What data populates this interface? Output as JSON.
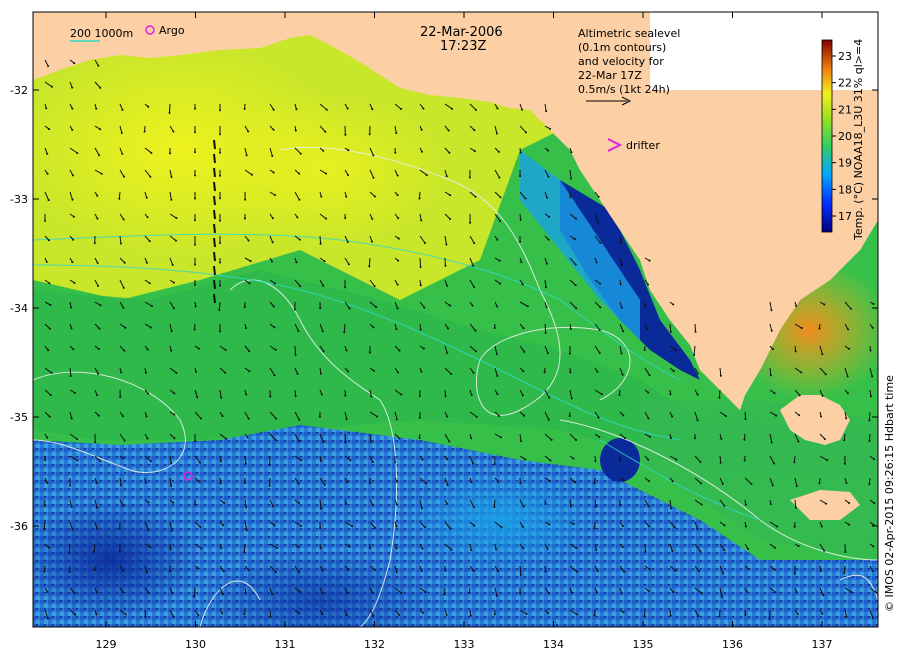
{
  "map": {
    "date": "22-Mar-2006",
    "time": "17:23Z",
    "altimetry_lines": [
      "Altimetric sealevel",
      "(0.1m contours)",
      "and velocity for",
      "22-Mar 17Z",
      "0.5m/s (1kt 24h)"
    ],
    "depth_legend": "200  1000m",
    "argo_label": "Argo",
    "drifter_label": "drifter",
    "colorbar_title": "Temp. (°C) NOAA18_L3U 31% ql>=4",
    "colorbar_ticks": [
      "17",
      "18",
      "19",
      "20",
      "21",
      "22",
      "23"
    ],
    "colorbar_range": [
      16.4,
      23.6
    ],
    "credit": "© IMOS 02-Apr-2015 09:26:15 Hdbart time",
    "lon_ticks": [
      "129",
      "130",
      "131",
      "132",
      "133",
      "134",
      "135",
      "136",
      "137"
    ],
    "lat_ticks": [
      "-32",
      "-33",
      "-34",
      "-35",
      "-36"
    ],
    "colors": {
      "land": "#fcd0a4",
      "warm": "#e6e62a",
      "mid": "#3cc23c",
      "cool": "#1e8ce6",
      "cold": "#0a1e8c",
      "hot": "#f0a020",
      "contour": "#e8f0e8",
      "depth_contour": "#30d8c8",
      "argo": "#e020e0"
    }
  }
}
